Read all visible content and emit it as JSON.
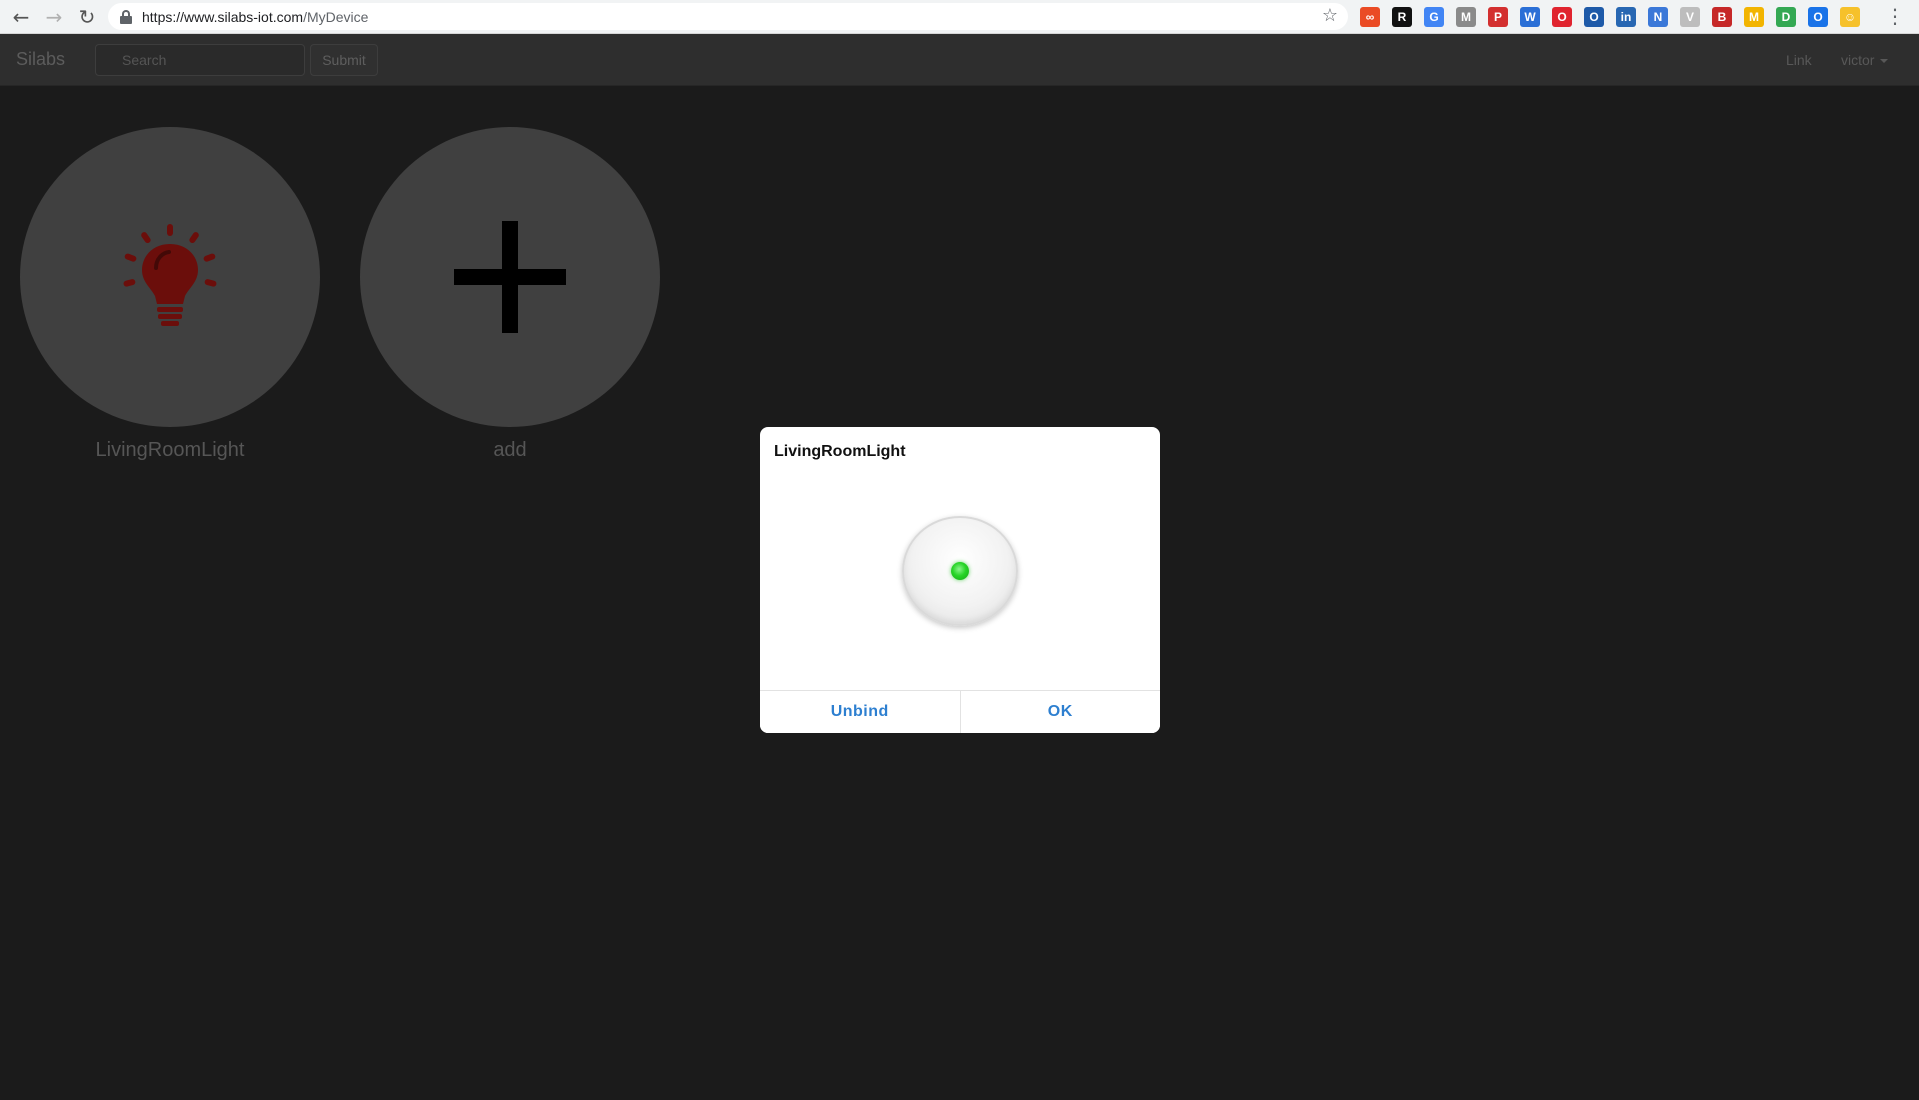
{
  "browser": {
    "url_host": "https://www.silabs-iot.com",
    "url_path": "/MyDevice",
    "extensions": [
      {
        "name": "infinity-ext-icon",
        "color": "#ea4b25",
        "glyph": "∞"
      },
      {
        "name": "readability-ext-icon",
        "color": "#111111",
        "glyph": "R"
      },
      {
        "name": "translate-ext-icon",
        "color": "#4285f4",
        "glyph": "G"
      },
      {
        "name": "gmail-ext-icon",
        "color": "#8a8a8a",
        "glyph": "M"
      },
      {
        "name": "pocket-ext-icon",
        "color": "#d32f2f",
        "glyph": "P"
      },
      {
        "name": "word-ext-icon",
        "color": "#2b6fd6",
        "glyph": "W"
      },
      {
        "name": "opera-ext-icon",
        "color": "#e0242f",
        "glyph": "O"
      },
      {
        "name": "outlook-ext-icon",
        "color": "#1e5aa8",
        "glyph": "O"
      },
      {
        "name": "linkedin-ext-icon",
        "color": "#2867b2",
        "glyph": "in"
      },
      {
        "name": "new-ext-icon",
        "color": "#3b78d8",
        "glyph": "N"
      },
      {
        "name": "vimium-ext-icon",
        "color": "#bdbdbd",
        "glyph": "V"
      },
      {
        "name": "bookmark-ext-icon",
        "color": "#c62828",
        "glyph": "B"
      },
      {
        "name": "m-ext-icon",
        "color": "#f2b400",
        "glyph": "M"
      },
      {
        "name": "drive-ext-icon",
        "color": "#34a853",
        "glyph": "D"
      },
      {
        "name": "circle-ext-icon",
        "color": "#1a73e8",
        "glyph": "O"
      },
      {
        "name": "emoji-ext-icon",
        "color": "#f6c12b",
        "glyph": "☺"
      }
    ]
  },
  "navbar": {
    "brand": "Silabs",
    "search_placeholder": "Search",
    "submit_label": "Submit",
    "link_label": "Link",
    "user_label": "victor"
  },
  "devices": [
    {
      "label": "LivingRoomLight",
      "icon": "lightbulb-icon",
      "color": "#6b0e0b"
    },
    {
      "label": "add",
      "icon": "plus-icon",
      "color": "#000000"
    }
  ],
  "dialog": {
    "title": "LivingRoomLight",
    "power_state": "on",
    "led_color": "#27d427",
    "unbind_label": "Unbind",
    "ok_label": "OK",
    "accent": "#2d7fd0"
  }
}
